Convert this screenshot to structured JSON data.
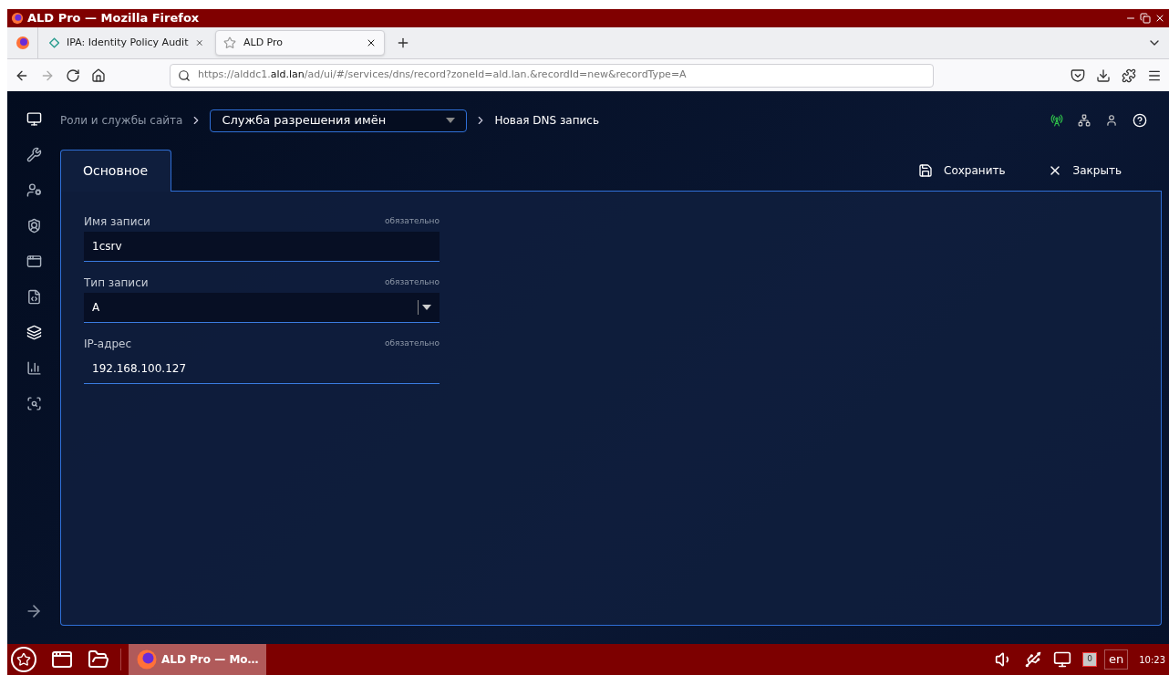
{
  "window": {
    "title": "ALD Pro — Mozilla Firefox"
  },
  "browser_tabs": [
    {
      "label": "IPA: Identity Policy Audit",
      "selected": false
    },
    {
      "label": "ALD Pro",
      "selected": true
    }
  ],
  "address_bar": {
    "url": "https://alddc1.**ald.lan**/ad/ui/#/services/dns/record?zoneId=ald.lan.&recordId=new&recordType=A"
  },
  "sidebar": {
    "items": [
      {
        "selected": false
      },
      {
        "selected": false
      },
      {
        "selected": false
      },
      {
        "selected": false
      },
      {
        "selected": false
      },
      {
        "selected": true
      },
      {
        "selected": false
      },
      {
        "selected": false
      }
    ]
  },
  "breadcrumb": {
    "root": "Роли и службы сайта",
    "service_select": "Служба разрешения имён",
    "current": "Новая DNS запись"
  },
  "tabs": [
    {
      "label": "Основное",
      "selected": true
    }
  ],
  "actions": [
    {
      "kind": "save",
      "label": "Сохранить"
    },
    {
      "kind": "close",
      "label": "Закрыть"
    }
  ],
  "fields": [
    {
      "kind": "text",
      "label": "Имя записи",
      "note": "обязательно",
      "value": "1csrv"
    },
    {
      "kind": "select",
      "label": "Тип записи",
      "note": "обязательно",
      "value": "A"
    },
    {
      "kind": "text",
      "label": "IP-адрес",
      "note": "обязательно",
      "value": "192.168.100.127"
    }
  ],
  "taskbar": {
    "app": "ALD Pro — Mo…",
    "notifications": "0",
    "language": "en",
    "time": "10:23"
  }
}
